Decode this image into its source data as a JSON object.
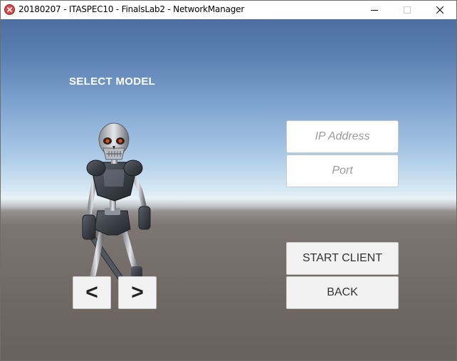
{
  "window": {
    "title": "20180207 - ITASPEC10 - FinalsLab2 - NetworkManager"
  },
  "scene": {
    "select_model_label": "SELECT MODEL",
    "character_model": "skeleton-warrior",
    "prev_label": "<",
    "next_label": ">"
  },
  "connection": {
    "ip_placeholder": "IP Address",
    "ip_value": "",
    "port_placeholder": "Port",
    "port_value": "",
    "start_client_label": "START CLIENT",
    "back_label": "BACK"
  },
  "colors": {
    "button_bg": "#f2f2f2",
    "button_text": "#333333",
    "placeholder_text": "#9a9a9a",
    "label_text": "#ffffff"
  },
  "icons": {
    "app": "unity-app-icon",
    "minimize": "minimize-icon",
    "maximize": "maximize-icon",
    "close": "close-icon"
  }
}
